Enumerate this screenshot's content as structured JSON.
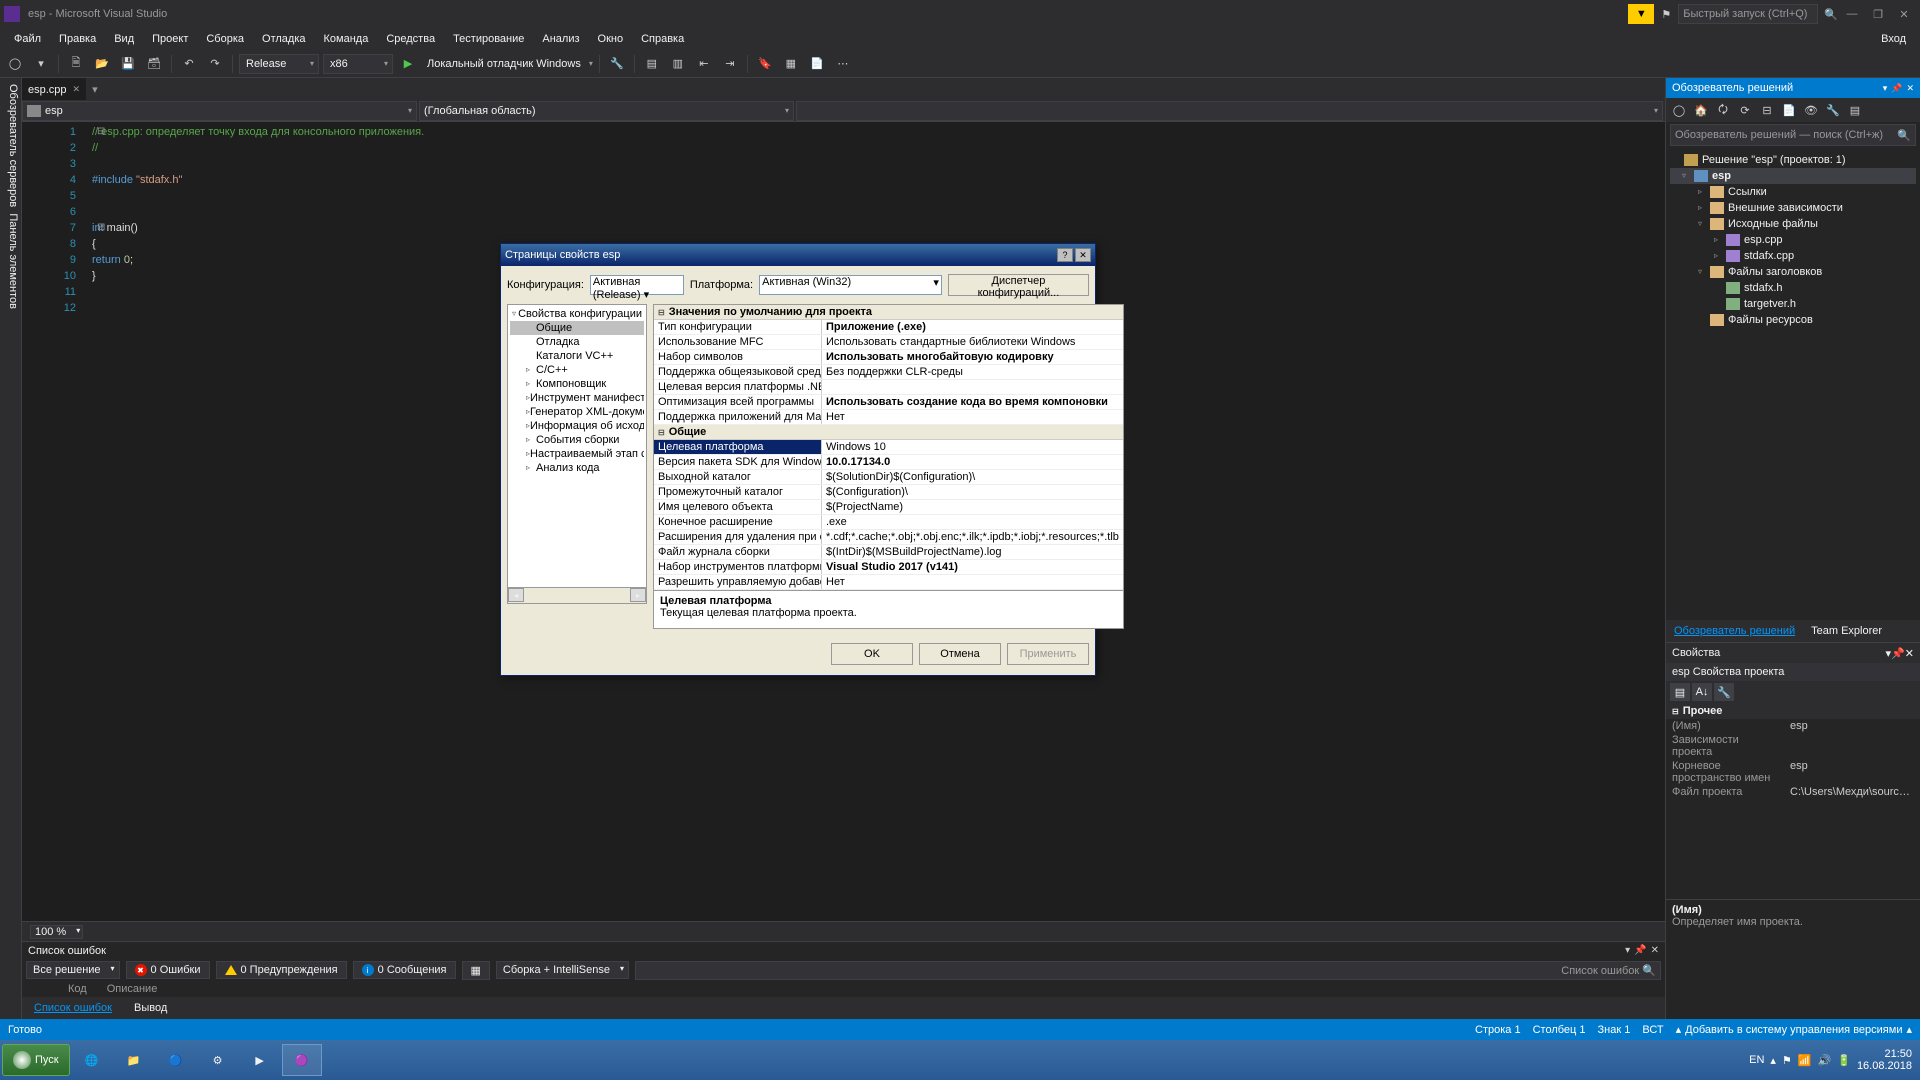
{
  "titlebar": {
    "title": "esp - Microsoft Visual Studio",
    "search_placeholder": "Быстрый запуск (Ctrl+Q)"
  },
  "menubar": {
    "items": [
      "Файл",
      "Правка",
      "Вид",
      "Проект",
      "Сборка",
      "Отладка",
      "Команда",
      "Средства",
      "Тестирование",
      "Анализ",
      "Окно",
      "Справка"
    ],
    "login": "Вход"
  },
  "toolbar": {
    "config": "Release",
    "platform": "x86",
    "debug_target": "Локальный отладчик Windows"
  },
  "tabs": {
    "active": "esp.cpp"
  },
  "navbar": {
    "scope": "esp",
    "context": "(Глобальная область)"
  },
  "code": {
    "lines": [
      {
        "n": 1,
        "html": "<span class='comment'>// esp.cpp: определяет точку входа для консольного приложения.</span>"
      },
      {
        "n": 2,
        "html": "<span class='comment'>//</span>"
      },
      {
        "n": 3,
        "html": ""
      },
      {
        "n": 4,
        "html": "<span class='kw'>#include</span> <span class='str'>\"stdafx.h\"</span>"
      },
      {
        "n": 5,
        "html": ""
      },
      {
        "n": 6,
        "html": ""
      },
      {
        "n": 7,
        "html": "<span class='kw'>int</span> main()"
      },
      {
        "n": 8,
        "html": "{"
      },
      {
        "n": 9,
        "html": "    <span class='kw'>return</span> <span class='num'>0</span>;"
      },
      {
        "n": 10,
        "html": "}"
      },
      {
        "n": 11,
        "html": ""
      },
      {
        "n": 12,
        "html": ""
      }
    ]
  },
  "zoom": "100 %",
  "sidetabs": [
    "Обозреватель серверов",
    "Панель элементов"
  ],
  "errorlist": {
    "title": "Список ошибок",
    "filter": "Все решение",
    "errors": "0 Ошибки",
    "warnings": "0 Предупреждения",
    "messages": "0 Сообщения",
    "build": "Сборка + IntelliSense",
    "search_ph": "Список ошибок",
    "cols": [
      "Код",
      "Описание"
    ]
  },
  "bottom_tabs": {
    "items": [
      "Список ошибок",
      "Вывод"
    ],
    "active": "Список ошибок"
  },
  "solution_explorer": {
    "title": "Обозреватель решений",
    "search_ph": "Обозреватель решений — поиск (Ctrl+ж)",
    "solution": "Решение \"esp\" (проектов: 1)",
    "project": "esp",
    "refs": "Ссылки",
    "ext": "Внешние зависимости",
    "src": "Исходные файлы",
    "srcfiles": [
      "esp.cpp",
      "stdafx.cpp"
    ],
    "hdr": "Файлы заголовков",
    "hdrfiles": [
      "stdafx.h",
      "targetver.h"
    ],
    "res": "Файлы ресурсов",
    "tabs": [
      "Обозреватель решений",
      "Team Explorer"
    ]
  },
  "properties": {
    "title": "Свойства",
    "object": "esp Свойства проекта",
    "cat": "Прочее",
    "rows": [
      {
        "n": "(Имя)",
        "v": "esp"
      },
      {
        "n": "Зависимости проекта",
        "v": ""
      },
      {
        "n": "Корневое пространство имен",
        "v": "esp"
      },
      {
        "n": "Файл проекта",
        "v": "C:\\Users\\Mехди\\source\\repos\\esp\\esp.vcxproj"
      }
    ],
    "desc_title": "(Имя)",
    "desc_body": "Определяет имя проекта."
  },
  "statusbar": {
    "ready": "Готово",
    "line": "Строка 1",
    "col": "Столбец 1",
    "ch": "Знак 1",
    "ins": "ВСТ",
    "add": "Добавить в систему управления версиями"
  },
  "taskbar": {
    "start": "Пуск",
    "lang": "EN",
    "time": "21:50",
    "date": "16.08.2018"
  },
  "dialog": {
    "title": "Страницы свойств esp",
    "config_label": "Конфигурация:",
    "config_val": "Активная (Release)",
    "platform_label": "Платформа:",
    "platform_val": "Активная (Win32)",
    "dispatch": "Диспетчер конфигураций...",
    "tree": [
      {
        "t": "Свойства конфигурации",
        "d": 0,
        "exp": "▿"
      },
      {
        "t": "Общие",
        "d": 1,
        "sel": true
      },
      {
        "t": "Отладка",
        "d": 1
      },
      {
        "t": "Каталоги VC++",
        "d": 1
      },
      {
        "t": "C/C++",
        "d": 1,
        "exp": "▹"
      },
      {
        "t": "Компоновщик",
        "d": 1,
        "exp": "▹"
      },
      {
        "t": "Инструмент манифеста",
        "d": 1,
        "exp": "▹"
      },
      {
        "t": "Генератор XML-документов",
        "d": 1,
        "exp": "▹"
      },
      {
        "t": "Информация об исходном коде",
        "d": 1,
        "exp": "▹"
      },
      {
        "t": "События сборки",
        "d": 1,
        "exp": "▹"
      },
      {
        "t": "Настраиваемый этап сборки",
        "d": 1,
        "exp": "▹"
      },
      {
        "t": "Анализ кода",
        "d": 1,
        "exp": "▹"
      }
    ],
    "cat1": "Значения по умолчанию для проекта",
    "rows1": [
      {
        "n": "Тип конфигурации",
        "v": "Приложение (.exe)",
        "b": true
      },
      {
        "n": "Использование MFC",
        "v": "Использовать стандартные библиотеки Windows"
      },
      {
        "n": "Набор символов",
        "v": "Использовать многобайтовую кодировку",
        "b": true
      },
      {
        "n": "Поддержка общеязыковой среды выполнения",
        "v": "Без поддержки CLR-среды"
      },
      {
        "n": "Целевая версия платформы .NET Framework",
        "v": ""
      },
      {
        "n": "Оптимизация всей программы",
        "v": "Использовать создание кода во время компоновки",
        "b": true
      },
      {
        "n": "Поддержка приложений для Магазина Windows",
        "v": "Нет"
      }
    ],
    "cat2": "Общие",
    "rows2": [
      {
        "n": "Целевая платформа",
        "v": "Windows 10",
        "sel": true
      },
      {
        "n": "Версия пакета SDK для Windows",
        "v": "10.0.17134.0",
        "b": true
      },
      {
        "n": "Выходной каталог",
        "v": "$(SolutionDir)$(Configuration)\\"
      },
      {
        "n": "Промежуточный каталог",
        "v": "$(Configuration)\\"
      },
      {
        "n": "Имя целевого объекта",
        "v": "$(ProjectName)"
      },
      {
        "n": "Конечное расширение",
        "v": ".exe"
      },
      {
        "n": "Расширения для удаления при очистке",
        "v": "*.cdf;*.cache;*.obj;*.obj.enc;*.ilk;*.ipdb;*.iobj;*.resources;*.tlb"
      },
      {
        "n": "Файл журнала сборки",
        "v": "$(IntDir)$(MSBuildProjectName).log"
      },
      {
        "n": "Набор инструментов платформы",
        "v": "Visual Studio 2017 (v141)",
        "b": true
      },
      {
        "n": "Разрешить управляемую добавочную сборку",
        "v": "Нет"
      }
    ],
    "desc_title": "Целевая платформа",
    "desc_body": "Текущая целевая платформа проекта.",
    "ok": "OK",
    "cancel": "Отмена",
    "apply": "Применить"
  }
}
